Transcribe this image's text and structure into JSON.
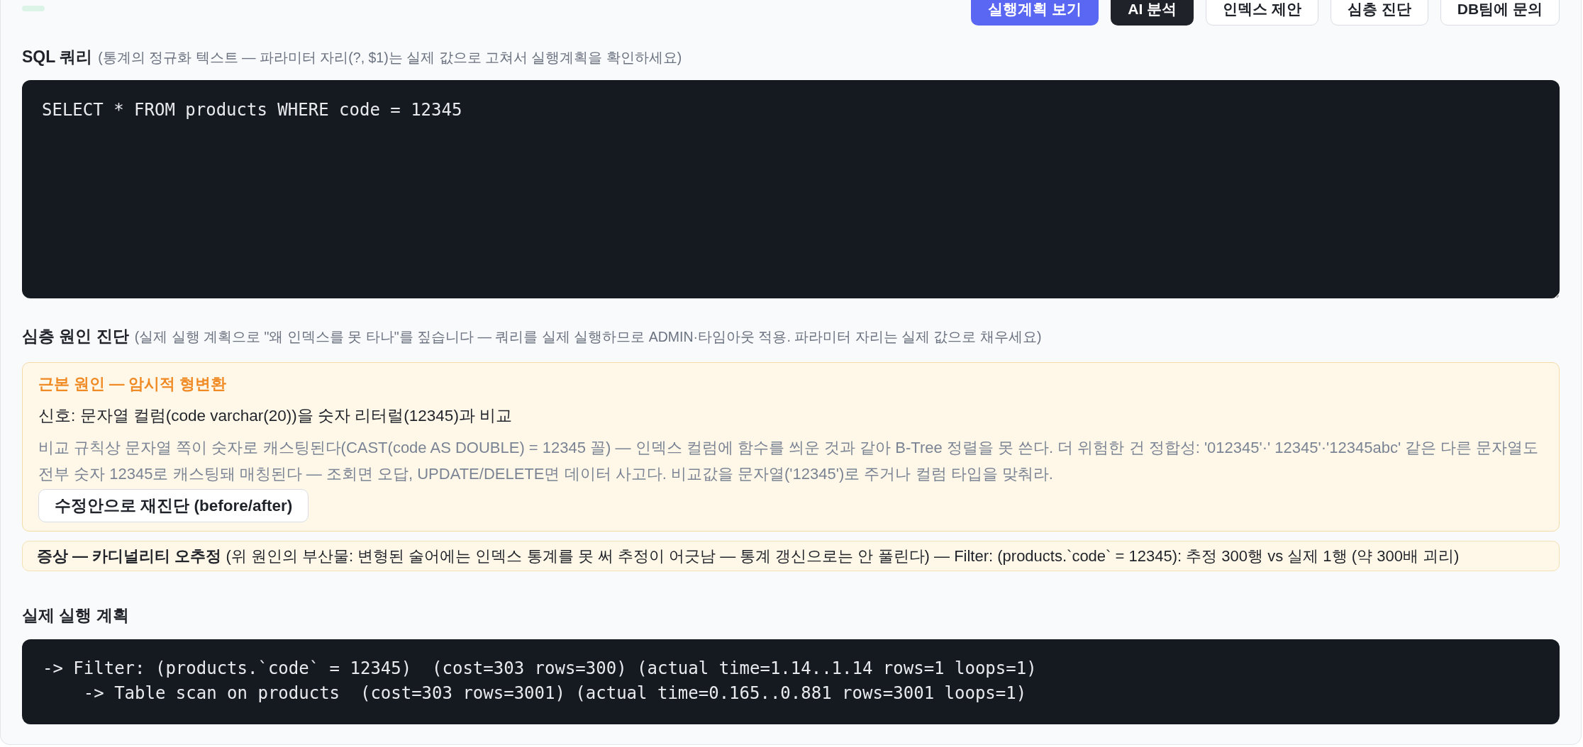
{
  "toolbar": {
    "buttons": [
      {
        "label": "실행계획 보기",
        "kind": "primary"
      },
      {
        "label": "AI 분석",
        "kind": "dark"
      },
      {
        "label": "인덱스 제안",
        "kind": "default"
      },
      {
        "label": "심층 진단",
        "kind": "default"
      },
      {
        "label": "DB팀에 문의",
        "kind": "default"
      }
    ]
  },
  "sql_query": {
    "label": "SQL 쿼리",
    "hint": "(통계의 정규화 텍스트 — 파라미터 자리(?, $1)는 실제 값으로 고쳐서 실행계획을 확인하세요)",
    "value": "SELECT * FROM products WHERE code = 12345"
  },
  "deep_diagnosis": {
    "label": "심층 원인 진단",
    "hint": "(실제 실행 계획으로 \"왜 인덱스를 못 타나\"를 짚습니다 — 쿼리를 실제 실행하므로 ADMIN·타임아웃 적용. 파라미터 자리는 실제 값으로 채우세요)",
    "findings": [
      {
        "kind": "root_cause",
        "title": "근본 원인 — 암시적 형변환",
        "signal": "신호: 문자열 컬럼(code varchar(20))을 숫자 리터럴(12345)과 비교",
        "explanation": "비교 규칙상 문자열 쪽이 숫자로 캐스팅된다(CAST(code AS DOUBLE) = 12345 꼴) — 인덱스 컬럼에 함수를 씌운 것과 같아 B-Tree 정렬을 못 쓴다. 더 위험한 건 정합성: '012345'·' 12345'·'12345abc' 같은 다른 문자열도 전부 숫자 12345로 캐스팅돼 매칭된다 — 조회면 오답, UPDATE/DELETE면 데이터 사고다. 비교값을 문자열('12345')로 주거나 컬럼 타입을 맞춰라.",
        "action": "수정안으로 재진단 (before/after)"
      },
      {
        "kind": "symptom",
        "text": "**증상 — 카디널리티 오추정** (위 원인의 부산물: 변형된 술어에는 인덱스 통계를 못 써 추정이 어긋남 — 통계 갱신으로는 안 풀린다) — Filter: (products.`code` = 12345): 추정 300행 vs 실제 1행 (약 300배 괴리)"
      }
    ]
  },
  "execution_plan": {
    "label": "실제 실행 계획",
    "lines": [
      "-> Filter: (products.`code` = 12345)  (cost=303 rows=300) (actual time=1.14..1.14 rows=1 loops=1)",
      "    -> Table scan on products  (cost=303 rows=3001) (actual time=0.165..0.881 rows=3001 loops=1)"
    ]
  }
}
